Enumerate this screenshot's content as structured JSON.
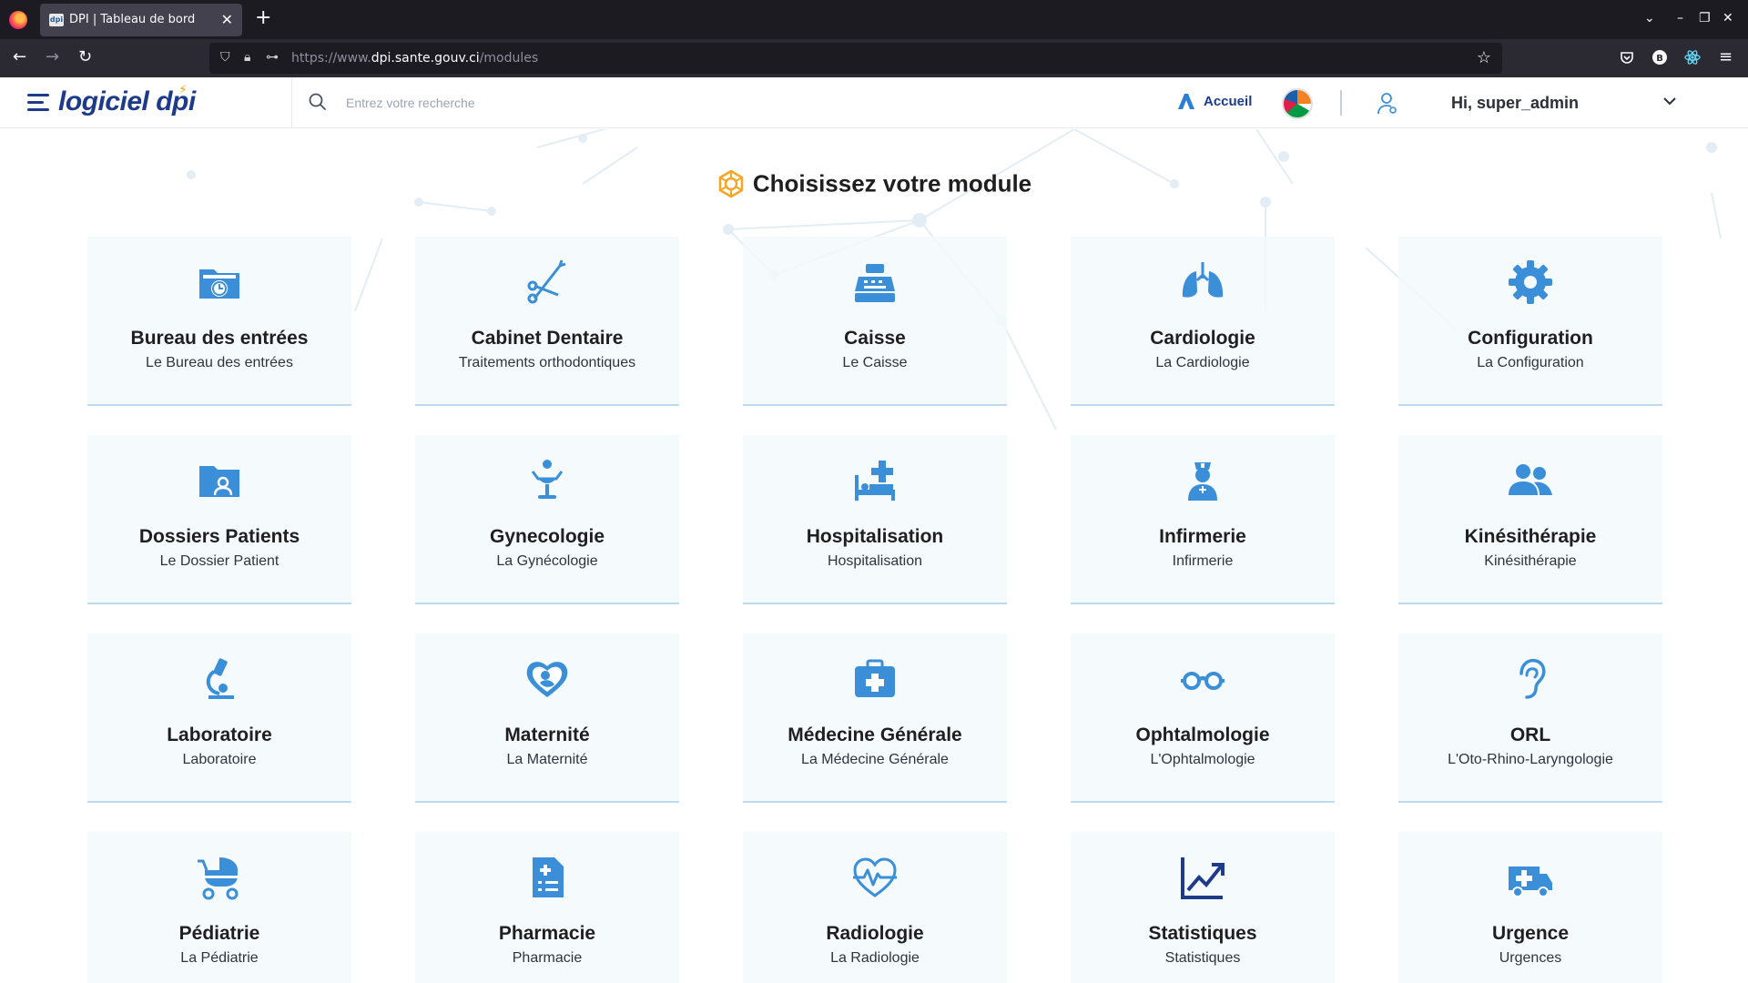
{
  "browser": {
    "tab_title": "DPI | Tableau de bord",
    "tab_favicon_text": "dpi",
    "url_prefix": "https://www.",
    "url_domain": "dpi.sante.gouv.ci",
    "url_path": "/modules",
    "icons": [
      "firefox-icon",
      "back-icon",
      "forward-icon",
      "reload-icon",
      "shield-icon",
      "lock-icon",
      "permissions-icon",
      "star-icon",
      "pocket-icon",
      "extension-icon",
      "menu-icon"
    ]
  },
  "header": {
    "logo_text": "logiciel",
    "logo_accent": "dpi",
    "search_placeholder": "Entrez votre recherche",
    "home_label": "Accueil",
    "user_greeting": "Hi, super_admin"
  },
  "main": {
    "title": "Choisissez votre module",
    "accent_color": "#3b8fd9",
    "modules": [
      {
        "title": "Bureau des entrées",
        "subtitle": "Le Bureau des entrées",
        "icon": "folder-clock-icon"
      },
      {
        "title": "Cabinet Dentaire",
        "subtitle": "Traitements orthodontiques",
        "icon": "dental-tools-icon"
      },
      {
        "title": "Caisse",
        "subtitle": "Le Caisse",
        "icon": "cash-register-icon"
      },
      {
        "title": "Cardiologie",
        "subtitle": "La Cardiologie",
        "icon": "lungs-icon"
      },
      {
        "title": "Configuration",
        "subtitle": "La Configuration",
        "icon": "gear-icon"
      },
      {
        "title": "Dossiers Patients",
        "subtitle": "Le Dossier Patient",
        "icon": "folder-user-icon"
      },
      {
        "title": "Gynecologie",
        "subtitle": "La Gynécologie",
        "icon": "gyneco-chair-icon"
      },
      {
        "title": "Hospitalisation",
        "subtitle": "Hospitalisation",
        "icon": "hospital-bed-icon"
      },
      {
        "title": "Infirmerie",
        "subtitle": "Infirmerie",
        "icon": "nurse-icon"
      },
      {
        "title": "Kinésithérapie",
        "subtitle": "Kinésithérapie",
        "icon": "users-icon"
      },
      {
        "title": "Laboratoire",
        "subtitle": "Laboratoire",
        "icon": "microscope-icon"
      },
      {
        "title": "Maternité",
        "subtitle": "La Maternité",
        "icon": "baby-heart-icon"
      },
      {
        "title": "Médecine Générale",
        "subtitle": "La Médecine Générale",
        "icon": "medical-kit-icon"
      },
      {
        "title": "Ophtalmologie",
        "subtitle": "L'Ophtalmologie",
        "icon": "glasses-icon"
      },
      {
        "title": "ORL",
        "subtitle": "L'Oto-Rhino-Laryngologie",
        "icon": "ear-icon"
      },
      {
        "title": "Pédiatrie",
        "subtitle": "La Pédiatrie",
        "icon": "baby-carriage-icon"
      },
      {
        "title": "Pharmacie",
        "subtitle": "Pharmacie",
        "icon": "prescription-icon"
      },
      {
        "title": "Radiologie",
        "subtitle": "La Radiologie",
        "icon": "heart-pulse-icon"
      },
      {
        "title": "Statistiques",
        "subtitle": "Statistiques",
        "icon": "chart-line-icon"
      },
      {
        "title": "Urgence",
        "subtitle": "Urgences",
        "icon": "ambulance-icon"
      }
    ]
  }
}
